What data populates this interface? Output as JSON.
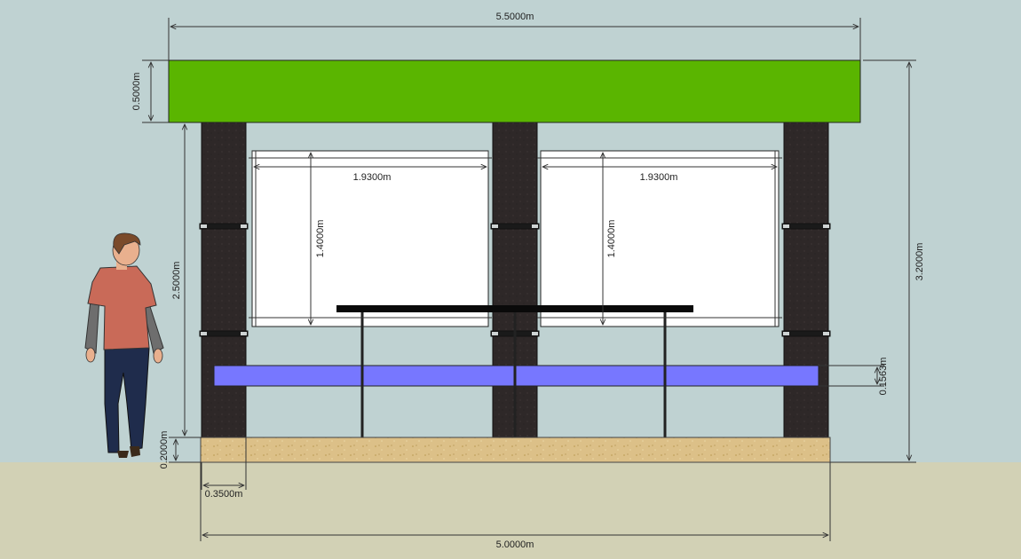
{
  "colors": {
    "sky": "#bfd2d2",
    "ground": "#d2d1b5",
    "roof": "#5ab500",
    "pillar": "#2e2828",
    "panel": "#ffffff",
    "bench": "#7777ff",
    "base": "#dcc088",
    "dimension_line": "#333333",
    "shirt": "#c96a58",
    "sleeve": "#6e6e6e",
    "pants": "#1f2c4c",
    "skin": "#e9b08e",
    "hair": "#7a4a2a"
  },
  "dimensions": {
    "roof_width": "5.5000m",
    "roof_height": "0.5000m",
    "total_height": "3.2000m",
    "pillar_height": "2.5000m",
    "panel_left_width": "1.9300m",
    "panel_right_width": "1.9300m",
    "panel_left_height": "1.4000m",
    "panel_right_height": "1.4000m",
    "bench_height": "0.1563m",
    "base_height": "0.2000m",
    "pillar_width": "0.3500m",
    "base_width": "5.0000m"
  }
}
